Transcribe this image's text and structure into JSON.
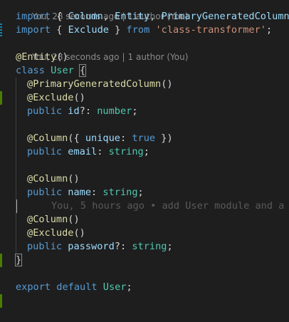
{
  "codelens": {
    "top": {
      "author_time": "You, 28 seconds ago",
      "authors": "1 author (You)"
    },
    "decorator": {
      "author_time": "You, 28 seconds ago",
      "authors": "1 author (You)"
    },
    "separator": "|"
  },
  "imports": [
    {
      "keyword": "import",
      "open": "{ ",
      "names": [
        "Column",
        "Entity",
        "PrimaryGeneratedColumn"
      ],
      "comma": ", ",
      "close": " }"
    },
    {
      "keyword": "import",
      "open": "{ ",
      "name": "Exclude",
      "close": " }",
      "from": "from",
      "source": "'class-transformer'",
      "semi": ";"
    }
  ],
  "entity_decorator": {
    "at": "@",
    "name": "Entity",
    "args": "()"
  },
  "class_decl": {
    "keyword": "class",
    "name": "User",
    "open": "{",
    "close": "}"
  },
  "members": {
    "id": {
      "dec1": {
        "at": "@",
        "name": "PrimaryGeneratedColumn",
        "args": "()"
      },
      "dec2": {
        "at": "@",
        "name": "Exclude",
        "args": "()"
      },
      "modifier": "public",
      "name": "id",
      "opt": "?: ",
      "type": "number",
      "semi": ";"
    },
    "email": {
      "dec_at": "@",
      "dec_name": "Column",
      "dec_open": "({ ",
      "opt_key": "unique",
      "colon": ": ",
      "opt_val": "true",
      "dec_close": " })",
      "modifier": "public",
      "name": "email",
      "sep": ": ",
      "type": "string",
      "semi": ";"
    },
    "name": {
      "dec": {
        "at": "@",
        "name": "Column",
        "args": "()"
      },
      "modifier": "public",
      "name": "name",
      "sep": ": ",
      "type": "string",
      "semi": ";"
    },
    "blame": "You, 5 hours ago • add User module and a",
    "password": {
      "dec1": {
        "at": "@",
        "name": "Column",
        "args": "()"
      },
      "dec2": {
        "at": "@",
        "name": "Exclude",
        "args": "()"
      },
      "modifier": "public",
      "name": "password",
      "opt": "?: ",
      "type": "string",
      "semi": ";"
    }
  },
  "export_stmt": {
    "keyword": "export",
    "default_kw": "default",
    "name": "User",
    "semi": ";"
  },
  "colors": {
    "background": "#1e1e1e",
    "keyword": "#569cd6",
    "function": "#dcdcaa",
    "class": "#4ec9b0",
    "string": "#ce9178",
    "property": "#9cdcfe",
    "added_gutter": "#487e02",
    "modified_gutter": "#1b81a8"
  }
}
